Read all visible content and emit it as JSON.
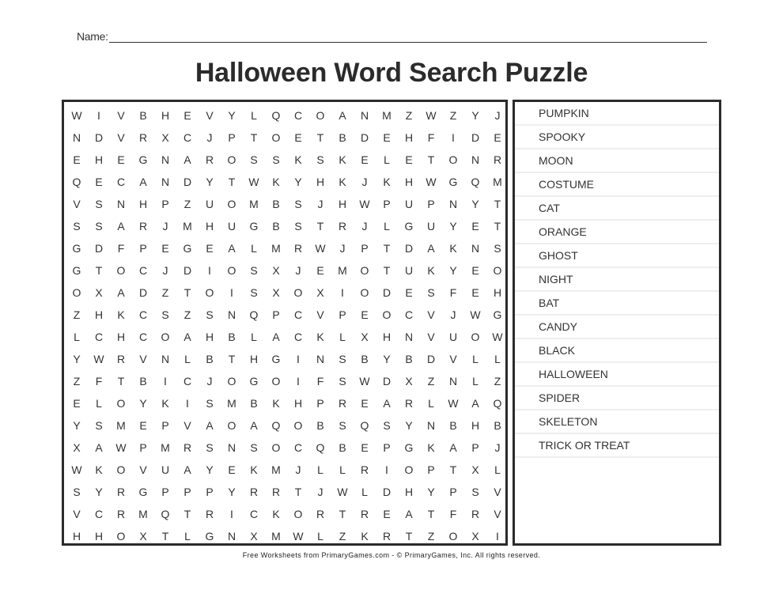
{
  "header": {
    "name_label": "Name:",
    "title": "Halloween Word Search Puzzle"
  },
  "grid": {
    "rows": [
      [
        "W",
        "I",
        "V",
        "B",
        "H",
        "E",
        "V",
        "Y",
        "L",
        "Q",
        "C",
        "O",
        "A",
        "N",
        "M",
        "Z",
        "W",
        "Z",
        "Y",
        "J"
      ],
      [
        "N",
        "D",
        "V",
        "R",
        "X",
        "C",
        "J",
        "P",
        "T",
        "O",
        "E",
        "T",
        "B",
        "D",
        "E",
        "H",
        "F",
        "I",
        "D",
        "E"
      ],
      [
        "E",
        "H",
        "E",
        "G",
        "N",
        "A",
        "R",
        "O",
        "S",
        "S",
        "K",
        "S",
        "K",
        "E",
        "L",
        "E",
        "T",
        "O",
        "N",
        "R"
      ],
      [
        "Q",
        "E",
        "C",
        "A",
        "N",
        "D",
        "Y",
        "T",
        "W",
        "K",
        "Y",
        "H",
        "K",
        "J",
        "K",
        "H",
        "W",
        "G",
        "Q",
        "M"
      ],
      [
        "V",
        "S",
        "N",
        "H",
        "P",
        "Z",
        "U",
        "O",
        "M",
        "B",
        "S",
        "J",
        "H",
        "W",
        "P",
        "U",
        "P",
        "N",
        "Y",
        "T"
      ],
      [
        "S",
        "S",
        "A",
        "R",
        "J",
        "M",
        "H",
        "U",
        "G",
        "B",
        "S",
        "T",
        "R",
        "J",
        "L",
        "G",
        "U",
        "Y",
        "E",
        "T"
      ],
      [
        "G",
        "D",
        "F",
        "P",
        "E",
        "G",
        "E",
        "A",
        "L",
        "M",
        "R",
        "W",
        "J",
        "P",
        "T",
        "D",
        "A",
        "K",
        "N",
        "S"
      ],
      [
        "G",
        "T",
        "O",
        "C",
        "J",
        "D",
        "I",
        "O",
        "S",
        "X",
        "J",
        "E",
        "M",
        "O",
        "T",
        "U",
        "K",
        "Y",
        "E",
        "O"
      ],
      [
        "O",
        "X",
        "A",
        "D",
        "Z",
        "T",
        "O",
        "I",
        "S",
        "X",
        "O",
        "X",
        "I",
        "O",
        "D",
        "E",
        "S",
        "F",
        "E",
        "H"
      ],
      [
        "Z",
        "H",
        "K",
        "C",
        "S",
        "Z",
        "S",
        "N",
        "Q",
        "P",
        "C",
        "V",
        "P",
        "E",
        "O",
        "C",
        "V",
        "J",
        "W",
        "G"
      ],
      [
        "L",
        "C",
        "H",
        "C",
        "O",
        "A",
        "H",
        "B",
        "L",
        "A",
        "C",
        "K",
        "L",
        "X",
        "H",
        "N",
        "V",
        "U",
        "O",
        "W"
      ],
      [
        "Y",
        "W",
        "R",
        "V",
        "N",
        "L",
        "B",
        "T",
        "H",
        "G",
        "I",
        "N",
        "S",
        "B",
        "Y",
        "B",
        "D",
        "V",
        "L",
        "L"
      ],
      [
        "Z",
        "F",
        "T",
        "B",
        "I",
        "C",
        "J",
        "O",
        "G",
        "O",
        "I",
        "F",
        "S",
        "W",
        "D",
        "X",
        "Z",
        "N",
        "L",
        "Z"
      ],
      [
        "E",
        "L",
        "O",
        "Y",
        "K",
        "I",
        "S",
        "M",
        "B",
        "K",
        "H",
        "P",
        "R",
        "E",
        "A",
        "R",
        "L",
        "W",
        "A",
        "Q"
      ],
      [
        "Y",
        "S",
        "M",
        "E",
        "P",
        "V",
        "A",
        "O",
        "A",
        "Q",
        "O",
        "B",
        "S",
        "Q",
        "S",
        "Y",
        "N",
        "B",
        "H",
        "B"
      ],
      [
        "X",
        "A",
        "W",
        "P",
        "M",
        "R",
        "S",
        "N",
        "S",
        "O",
        "C",
        "Q",
        "B",
        "E",
        "P",
        "G",
        "K",
        "A",
        "P",
        "J"
      ],
      [
        "W",
        "K",
        "O",
        "V",
        "U",
        "A",
        "Y",
        "E",
        "K",
        "M",
        "J",
        "L",
        "L",
        "R",
        "I",
        "O",
        "P",
        "T",
        "X",
        "L"
      ],
      [
        "S",
        "Y",
        "R",
        "G",
        "P",
        "P",
        "P",
        "Y",
        "R",
        "R",
        "T",
        "J",
        "W",
        "L",
        "D",
        "H",
        "Y",
        "P",
        "S",
        "V"
      ],
      [
        "V",
        "C",
        "R",
        "M",
        "Q",
        "T",
        "R",
        "I",
        "C",
        "K",
        "O",
        "R",
        "T",
        "R",
        "E",
        "A",
        "T",
        "F",
        "R",
        "V"
      ],
      [
        "H",
        "H",
        "O",
        "X",
        "T",
        "L",
        "G",
        "N",
        "X",
        "M",
        "W",
        "L",
        "Z",
        "K",
        "R",
        "T",
        "Z",
        "O",
        "X",
        "I"
      ]
    ]
  },
  "word_list": [
    "PUMPKIN",
    "SPOOKY",
    "MOON",
    "COSTUME",
    "CAT",
    "ORANGE",
    "GHOST",
    "NIGHT",
    "BAT",
    "CANDY",
    "BLACK",
    "HALLOWEEN",
    "SPIDER",
    "SKELETON",
    "TRICK OR TREAT"
  ],
  "footer": {
    "text": "Free Worksheets from PrimaryGames.com - © PrimaryGames, Inc. All rights reserved."
  }
}
